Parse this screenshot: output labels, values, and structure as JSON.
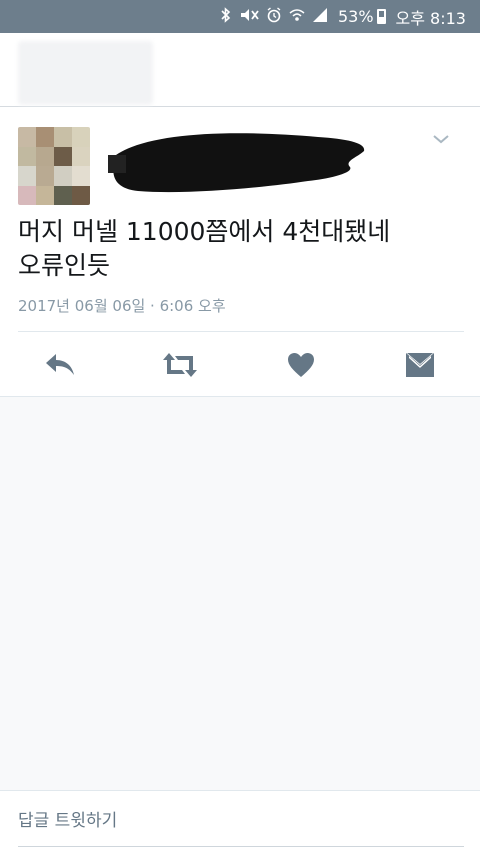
{
  "status_bar": {
    "battery": "53%",
    "time": "오후 8:13",
    "icons": [
      "bluetooth-icon",
      "mute-icon",
      "alarm-icon",
      "wifi-icon",
      "signal-icon",
      "battery-icon"
    ]
  },
  "tweet": {
    "text_line1": "머지 머넬 11000쯤에서 4천대됐네",
    "text_line2": "오류인듯",
    "timestamp": "2017년 06월 06일 · 6:06 오후",
    "actions": [
      "reply-icon",
      "retweet-icon",
      "like-icon",
      "message-icon"
    ]
  },
  "reply": {
    "placeholder": "답글 트윗하기"
  },
  "colors": {
    "status_bar": "#6d7e8c",
    "icon_gray": "#657786",
    "meta_gray": "#8899a6",
    "avatar_tiles": [
      "#c7b9a4",
      "#a88f74",
      "#c8bfa6",
      "#d8d2bb",
      "#c1b9a0",
      "#b7a88f",
      "#6d5c48",
      "#dad3bf",
      "#d7d6cc",
      "#b9aa92",
      "#d1cec2",
      "#e3ddd0",
      "#d7b9bb",
      "#c5b699",
      "#5f604f",
      "#6e5a45"
    ]
  }
}
